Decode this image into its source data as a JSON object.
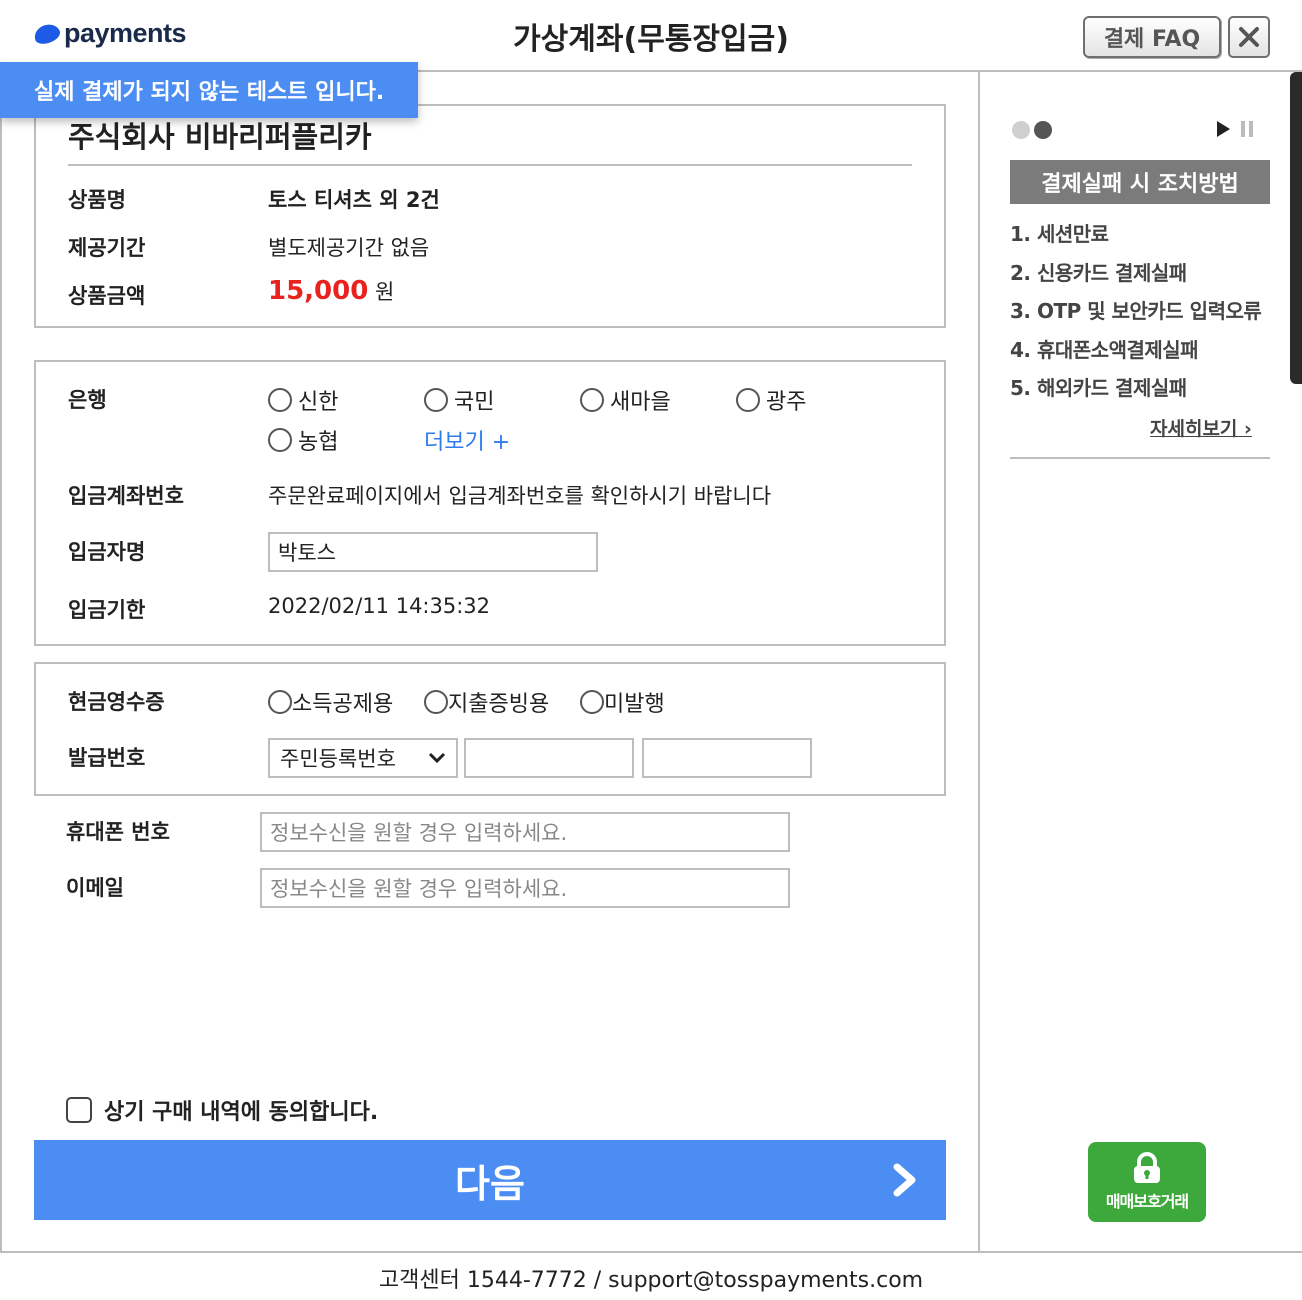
{
  "header": {
    "logo_text": "payments",
    "title": "가상계좌(무통장입금)",
    "faq_label": "결제 FAQ",
    "close_icon": "close-icon"
  },
  "test_banner": "실제 결제가 되지 않는 테스트 입니다.",
  "order": {
    "company": "주식회사 비바리퍼플리카",
    "product_label": "상품명",
    "product_value": "토스 티셔츠 외 2건",
    "period_label": "제공기간",
    "period_value": "별도제공기간 없음",
    "amount_label": "상품금액",
    "amount_value": "15,000",
    "amount_unit": "원"
  },
  "bank": {
    "label": "은행",
    "options": [
      "신한",
      "국민",
      "새마을",
      "광주",
      "농협"
    ],
    "more_label": "더보기 +",
    "account_label": "입금계좌번호",
    "account_value": "주문완료페이지에서 입금계좌번호를 확인하시기 바랍니다",
    "depositor_label": "입금자명",
    "depositor_value": "박토스",
    "deadline_label": "입금기한",
    "deadline_value": "2022/02/11 14:35:32"
  },
  "receipt": {
    "label": "현금영수증",
    "options": [
      "소득공제용",
      "지출증빙용",
      "미발행"
    ],
    "issue_label": "발급번호",
    "issue_select": "주민등록번호"
  },
  "contact": {
    "phone_label": "휴대폰 번호",
    "phone_placeholder": "정보수신을 원할 경우 입력하세요.",
    "email_label": "이메일",
    "email_placeholder": "정보수신을 원할 경우 입력하세요."
  },
  "agree_label": "상기 구매 내역에 동의합니다.",
  "next_label": "다음",
  "footer": "고객센터 1544-7772 / support@tosspayments.com",
  "sidebar": {
    "title": "결제실패 시 조치방법",
    "items": [
      "1. 세션만료",
      "2. 신용카드 결제실패",
      "3. OTP 및 보안카드 입력오류",
      "4. 휴대폰소액결제실패",
      "5. 해외카드 결제실패"
    ],
    "more_label": "자세히보기 ›",
    "secure_label": "매매보호거래"
  },
  "colors": {
    "accent": "#4b8df2",
    "price": "#e8231f",
    "link": "#2f7cf0",
    "secure": "#3da83b"
  }
}
